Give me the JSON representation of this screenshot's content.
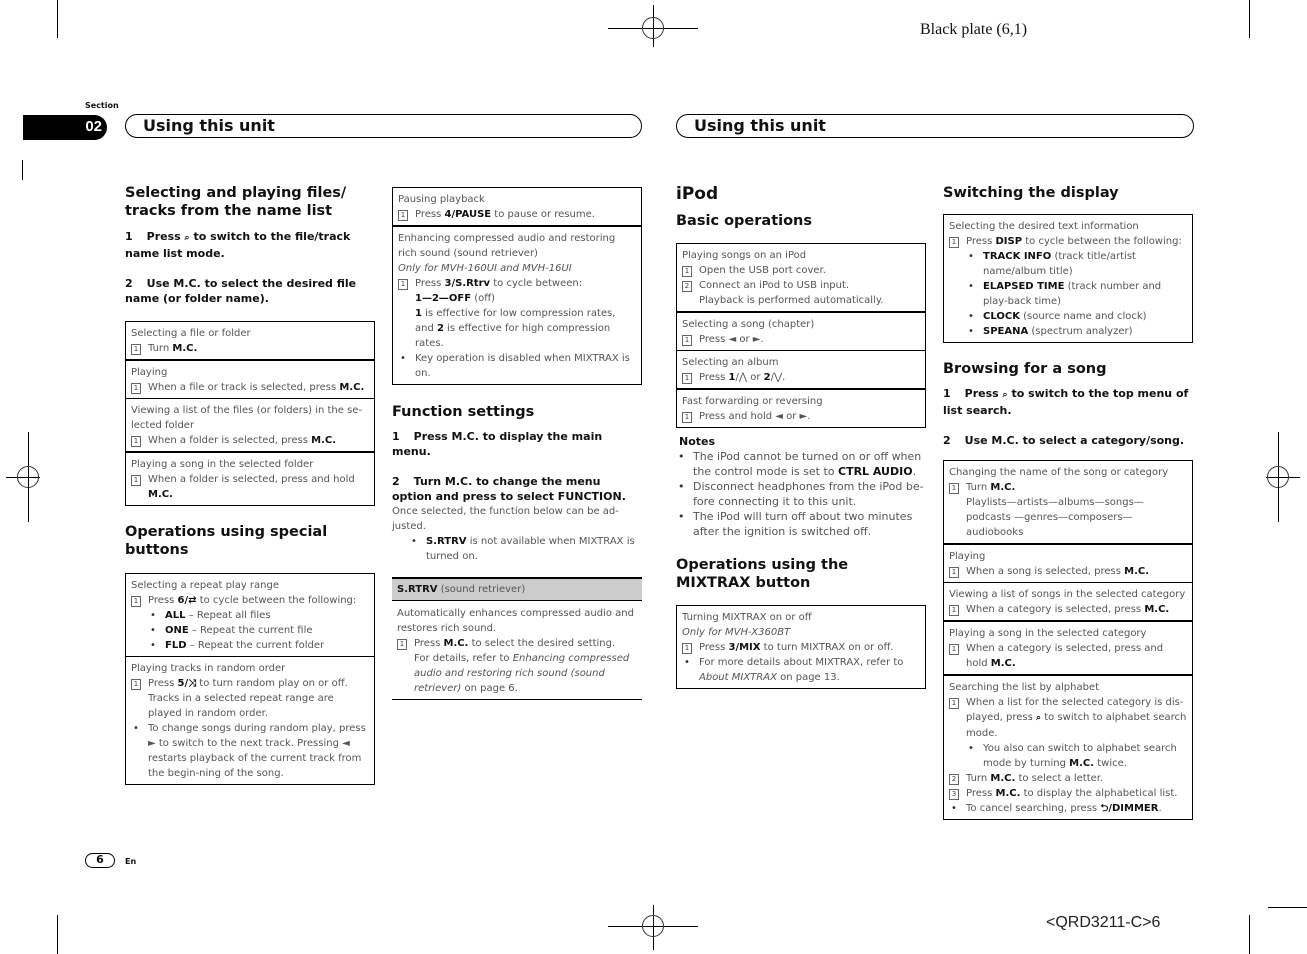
{
  "plate": "Black plate (6,1)",
  "section": {
    "label": "Section",
    "number": "02"
  },
  "headers": {
    "left": "Using this unit",
    "right": "Using this unit"
  },
  "footer": {
    "page": "6",
    "lang": "En",
    "code": "<QRD3211-C>6"
  },
  "col1": {
    "title": "Selecting and playing files/ tracks from the name list",
    "step1": {
      "num": "1",
      "pre": "Press",
      "icon": "search-icon",
      "post": "to switch to the file/track name list mode."
    },
    "step2": {
      "num": "2",
      "text": "Use M.C. to select the desired file name (or folder name)."
    },
    "table": [
      {
        "title": "Selecting a file or folder",
        "step": "Turn ",
        "bold": "M.C."
      },
      {
        "title": "Playing",
        "step": "When a file or track is selected, press ",
        "bold": "M.C."
      },
      {
        "title": "Viewing a list of the files (or folders) in the se-lected folder",
        "step": "When a folder is selected, press ",
        "bold": "M.C."
      },
      {
        "title": "Playing a song in the selected folder",
        "step": "When a folder is selected, press and hold ",
        "bold": "M.C."
      }
    ],
    "title2": "Operations using special buttons",
    "repeat": {
      "title": "Selecting a repeat play range",
      "step_pre": "Press ",
      "step_bold": "6/",
      "step_post": " to cycle between the following:",
      "options": [
        {
          "bold": "ALL",
          "text": " – Repeat all files"
        },
        {
          "bold": "ONE",
          "text": " – Repeat the current file"
        },
        {
          "bold": "FLD",
          "text": " – Repeat the current folder"
        }
      ]
    },
    "random": {
      "title": "Playing tracks in random order",
      "step_pre": "Press ",
      "step_bold": "5/",
      "step_post": " to turn random play on or off. Tracks in a selected repeat range are played in random order.",
      "bullet": "To change songs during random play, press ► to switch to the next track. Pressing ◄ restarts playback of the current track from the begin-ning of the song."
    }
  },
  "col2": {
    "pause": {
      "title": "Pausing playback",
      "pre": "Press ",
      "bold": "4/PAUSE",
      "post": " to pause or resume."
    },
    "enhance": {
      "title": "Enhancing compressed audio and restoring rich sound (sound retriever)",
      "only": "Only for MVH-160UI and MVH-16UI",
      "step_pre": "Press ",
      "step_bold": "3/S.Rtrv",
      "step_post": " to cycle between:",
      "cycle_bold": "1—2—OFF",
      "cycle_post": " (off)",
      "effect_b1": "1",
      "effect_t1": " is effective for low compression rates, and ",
      "effect_b2": "2",
      "effect_t2": " is effective for high compression rates.",
      "bullet": "Key operation is disabled when MIXTRAX is on."
    },
    "title": "Function settings",
    "step1": {
      "num": "1",
      "text": "Press M.C. to display the main menu."
    },
    "step2": {
      "num": "2",
      "text": "Turn M.C. to change the menu option and press to select FUNCTION."
    },
    "desc": "Once selected, the function below can be ad-justed.",
    "bullet_bold": "S.RTRV",
    "bullet_text": " is not available when MIXTRAX is turned on.",
    "srtrv": {
      "head_bold": "S.RTRV",
      "head_text": " (sound retriever)",
      "desc": "Automatically enhances compressed audio and restores rich sound.",
      "step_pre": "Press ",
      "step_bold": "M.C.",
      "step_post": " to select the desired setting.",
      "ref_pre": "For details, refer to ",
      "ref_italic": "Enhancing compressed audio and restoring rich sound (sound retriever)",
      "ref_post": " on page 6."
    }
  },
  "col3": {
    "title": "iPod",
    "subtitle": "Basic operations",
    "table": {
      "playing": {
        "title": "Playing songs on an iPod",
        "s1": "Open the USB port cover.",
        "s2": "Connect an iPod to USB input.",
        "s2b": "Playback is performed automatically."
      },
      "song": {
        "title": "Selecting a song (chapter)",
        "step": "Press ◄ or ►."
      },
      "album": {
        "title": "Selecting an album",
        "pre": "Press ",
        "b1": "1",
        "m1": "/⋀ or ",
        "b2": "2",
        "m2": "/⋁."
      },
      "ff": {
        "title": "Fast forwarding or reversing",
        "step": "Press and hold ◄ or ►."
      }
    },
    "notes_title": "Notes",
    "notes": [
      {
        "text": "The iPod cannot be turned on or off when the control mode is set to ",
        "bold": "CTRL AUDIO",
        "post": "."
      },
      {
        "text": "Disconnect headphones from the iPod be-fore connecting it to this unit.",
        "bold": "",
        "post": ""
      },
      {
        "text": "The iPod will turn off about two minutes after the ignition is switched off.",
        "bold": "",
        "post": ""
      }
    ],
    "title2": "Operations using the MIXTRAX button",
    "mixtrax": {
      "title": "Turning MIXTRAX on or off",
      "only": "Only for MVH-X360BT",
      "step_pre": "Press ",
      "step_bold": "3/MIX",
      "step_post": " to turn MIXTRAX on or off.",
      "bullet_pre": "For more details about MIXTRAX, refer to ",
      "bullet_italic": "About MIXTRAX",
      "bullet_post": " on page 13."
    }
  },
  "col4": {
    "title": "Switching the display",
    "display": {
      "title": "Selecting the desired text information",
      "step_pre": "Press ",
      "step_bold": "DISP",
      "step_post": " to cycle between the following:",
      "options": [
        {
          "bold": "TRACK INFO",
          "text": " (track title/artist name/album title)"
        },
        {
          "bold": "ELAPSED TIME",
          "text": " (track number and play-back time)"
        },
        {
          "bold": "CLOCK",
          "text": " (source name and clock)"
        },
        {
          "bold": "SPEANA",
          "text": " (spectrum analyzer)"
        }
      ]
    },
    "title2": "Browsing for a song",
    "step1": {
      "num": "1",
      "pre": "Press",
      "post": "to switch to the top menu of list search."
    },
    "step2": {
      "num": "2",
      "text": "Use M.C. to select a category/song."
    },
    "table": {
      "change": {
        "title": "Changing the name of the song or category",
        "pre": "Turn ",
        "bold": "M.C.",
        "list": "Playlists—artists—albums—songs—podcasts —genres—composers—audiobooks"
      },
      "playing": {
        "title": "Playing",
        "pre": "When a song is selected, press ",
        "bold": "M.C."
      },
      "viewing": {
        "title": "Viewing a list of songs in the selected category",
        "pre": "When a category is selected, press ",
        "bold": "M.C."
      },
      "playcat": {
        "title": "Playing a song in the selected category",
        "pre": "When a category is selected, press and hold ",
        "bold": "M.C."
      },
      "alpha": {
        "title": "Searching the list by alphabet",
        "s1_pre": "When a list for the selected category is dis-played, press ",
        "s1_post": " to switch to alphabet search mode.",
        "sub_pre": "You also can switch to alphabet search mode by turning ",
        "sub_bold": "M.C.",
        "sub_post": " twice.",
        "s2_pre": "Turn ",
        "s2_bold": "M.C.",
        "s2_post": " to select a letter.",
        "s3_pre": "Press ",
        "s3_bold": "M.C.",
        "s3_post": " to display the alphabetical list.",
        "cancel_pre": "To cancel searching, press ",
        "cancel_bold": "/DIMMER",
        "cancel_post": "."
      }
    }
  }
}
